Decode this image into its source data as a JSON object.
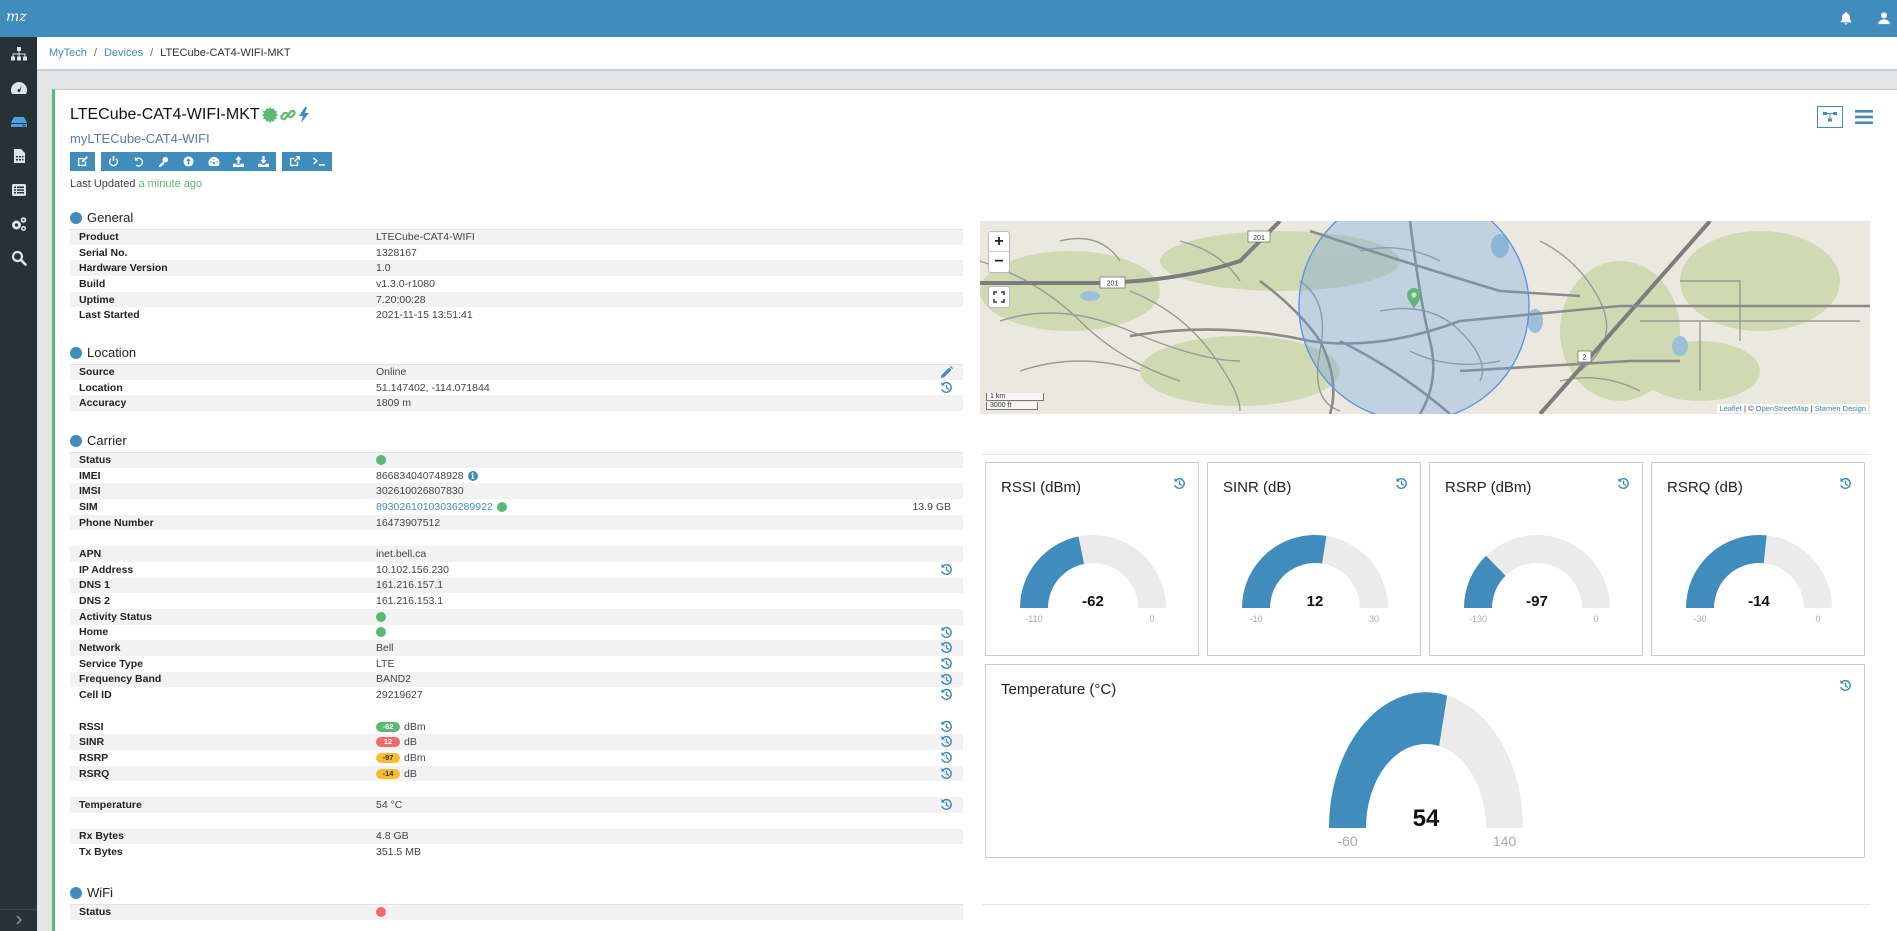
{
  "app": {
    "logo_text": "mz",
    "topbar_icons": [
      "bell-icon",
      "user-icon"
    ]
  },
  "sidebar": {
    "items": [
      {
        "name": "sitemap-icon",
        "active": false
      },
      {
        "name": "dashboard-icon",
        "active": false
      },
      {
        "name": "devices-icon",
        "active": true
      },
      {
        "name": "sim-card-icon",
        "active": false
      },
      {
        "name": "list-icon",
        "active": false
      },
      {
        "name": "settings-icon",
        "active": false
      },
      {
        "name": "search-icon",
        "active": false
      }
    ],
    "expand_icon": "chevron-right-icon"
  },
  "breadcrumb": [
    {
      "label": "MyTech",
      "link": true
    },
    {
      "label": "Devices",
      "link": true
    },
    {
      "label": "LTECube-CAT4-WIFI-MKT",
      "link": false
    }
  ],
  "device": {
    "title": "LTECube-CAT4-WIFI-MKT",
    "status_icons": [
      "certificate-icon",
      "link-icon",
      "bolt-icon"
    ],
    "subtitle": "myLTECube-CAT4-WIFI",
    "last_updated_label": "Last Updated",
    "last_updated_value": "a minute ago"
  },
  "toolbar": {
    "groups": [
      [
        "edit-icon"
      ],
      [
        "power-icon",
        "undo-icon",
        "key-icon",
        "upgrade-icon",
        "speedometer-icon",
        "upload-icon",
        "download-icon"
      ],
      [
        "external-link-icon",
        "terminal-icon"
      ]
    ],
    "right": [
      "topology-icon",
      "menu-icon"
    ]
  },
  "sections": {
    "general": {
      "title": "General",
      "rows": [
        {
          "key": "Product",
          "value": "LTECube-CAT4-WIFI"
        },
        {
          "key": "Serial No.",
          "value": "1328167"
        },
        {
          "key": "Hardware Version",
          "value": "1.0"
        },
        {
          "key": "Build",
          "value": "v1.3.0-r1080"
        },
        {
          "key": "Uptime",
          "value": "7.20:00:28"
        },
        {
          "key": "Last Started",
          "value": "2021-11-15 13:51:41"
        }
      ]
    },
    "location": {
      "title": "Location",
      "rows": [
        {
          "key": "Source",
          "value": "Online",
          "action": "pencil-icon"
        },
        {
          "key": "Location",
          "value": "51.147402, -114.071844",
          "action": "history-icon"
        },
        {
          "key": "Accuracy",
          "value": "1809 m"
        }
      ]
    },
    "carrier": {
      "title": "Carrier",
      "rows": [
        {
          "key": "Status",
          "dot": "#5cb874"
        },
        {
          "key": "IMEI",
          "value": "866834040748928",
          "info": true
        },
        {
          "key": "IMSI",
          "value": "302610026807830"
        },
        {
          "key": "SIM",
          "value": "89302610103036289922",
          "link": true,
          "dot": "#5cb874",
          "extra": "13.9 GB"
        },
        {
          "key": "Phone Number",
          "value": "16473907512"
        },
        {
          "gap": true
        },
        {
          "key": "APN",
          "value": "inet.bell.ca"
        },
        {
          "key": "IP Address",
          "value": "10.102.156.230",
          "action": "history-icon"
        },
        {
          "key": "DNS 1",
          "value": "161.216.157.1"
        },
        {
          "key": "DNS 2",
          "value": "161.216.153.1"
        },
        {
          "key": "Activity Status",
          "dot": "#5cb874"
        },
        {
          "key": "Home",
          "dot": "#5cb874",
          "action": "history-icon"
        },
        {
          "key": "Network",
          "value": "Bell",
          "action": "history-icon"
        },
        {
          "key": "Service Type",
          "value": "LTE",
          "action": "history-icon"
        },
        {
          "key": "Frequency Band",
          "value": "BAND2",
          "action": "history-icon"
        },
        {
          "key": "Cell ID",
          "value": "29219627",
          "action": "history-icon"
        },
        {
          "gap": true
        },
        {
          "key": "RSSI",
          "pill": "-62",
          "pill_color": "#5cb874",
          "pill_text": "#fff",
          "unit": "dBm",
          "action": "history-icon"
        },
        {
          "key": "SINR",
          "pill": "12",
          "pill_color": "#ef6a6a",
          "pill_text": "#fff",
          "unit": "dB",
          "action": "history-icon"
        },
        {
          "key": "RSRP",
          "pill": "-97",
          "pill_color": "#fbbd2d",
          "pill_text": "#333",
          "unit": "dBm",
          "action": "history-icon"
        },
        {
          "key": "RSRQ",
          "pill": "-14",
          "pill_color": "#fbbd2d",
          "pill_text": "#333",
          "unit": "dB",
          "action": "history-icon"
        },
        {
          "gap": true
        },
        {
          "key": "Temperature",
          "value": "54 °C",
          "action": "history-icon"
        },
        {
          "gap": true
        },
        {
          "key": "Rx Bytes",
          "value": "4.8 GB"
        },
        {
          "key": "Tx Bytes",
          "value": "351.5 MB"
        }
      ]
    },
    "wifi": {
      "title": "WiFi",
      "rows": [
        {
          "key": "Status",
          "dot": "#ef6a6a"
        }
      ]
    }
  },
  "map": {
    "zoom_in": "+",
    "zoom_out": "−",
    "fullscreen_icon": "fullscreen-icon",
    "marker_icon": "map-marker-icon",
    "scale_km": "1 km",
    "scale_ft": "3000 ft",
    "road_labels": [
      "201",
      "201",
      "2"
    ],
    "attribution": {
      "leaflet": "Leaflet",
      "sep1": " | © ",
      "osm": "OpenStreetMap",
      "sep2": " | ",
      "stamen": "Stamen Design"
    }
  },
  "colors": {
    "brand": "#3f8cbd",
    "success": "#5cb874",
    "danger": "#ef6a6a",
    "warning": "#fbbd2d",
    "gauge_track": "#ebebeb"
  },
  "chart_data": [
    {
      "type": "gauge",
      "title": "RSSI (dBm)",
      "value": -62,
      "min": -110,
      "max": 0
    },
    {
      "type": "gauge",
      "title": "SINR (dB)",
      "value": 12,
      "min": -10,
      "max": 30
    },
    {
      "type": "gauge",
      "title": "RSRP (dBm)",
      "value": -97,
      "min": -130,
      "max": 0
    },
    {
      "type": "gauge",
      "title": "RSRQ (dB)",
      "value": -14,
      "min": -30,
      "max": 0
    },
    {
      "type": "gauge",
      "title": "Temperature (°C)",
      "value": 54,
      "min": -60,
      "max": 140
    }
  ]
}
